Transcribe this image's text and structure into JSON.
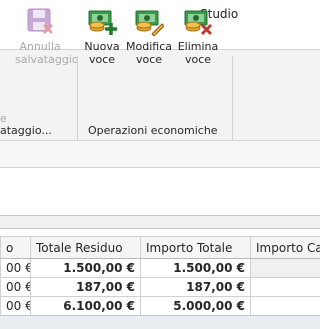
{
  "app": {
    "title": "Studio"
  },
  "ribbon": {
    "cancel_save": {
      "line1": "Annulla",
      "line2": "salvataggio",
      "prefix": "e"
    },
    "left_group_label": "ataggio...",
    "economic_group": {
      "label": "Operazioni economiche",
      "buttons": [
        {
          "line1": "Nuova",
          "line2": "voce",
          "icon": "money-add-icon"
        },
        {
          "line1": "Modifica",
          "line2": "voce",
          "icon": "money-edit-icon"
        },
        {
          "line1": "Elimina",
          "line2": "voce",
          "icon": "money-delete-icon"
        }
      ]
    }
  },
  "grid": {
    "columns": [
      "o",
      "Totale Residuo",
      "Importo Totale",
      "Importo Cas"
    ],
    "rows": [
      [
        "00 €",
        "1.500,00 €",
        "1.500,00 €",
        ""
      ],
      [
        "00 €",
        "187,00 €",
        "187,00 €",
        ""
      ],
      [
        "00 €",
        "6.100,00 €",
        "5.000,00 €",
        ""
      ]
    ]
  },
  "colors": {
    "accent_green": "#2e8b3a",
    "delete_red": "#c0392b",
    "coin_gold": "#e4a72a",
    "disabled_gray": "#a9a9a9"
  }
}
